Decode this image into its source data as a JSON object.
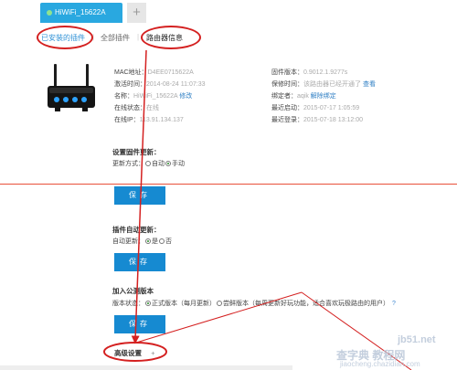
{
  "tabs": {
    "device_label": "HiWiFi_15622A",
    "add_label": "+"
  },
  "subnav": {
    "installed": "已安装的插件",
    "sep": "|",
    "all": "全部插件",
    "router_info": "路由器信息"
  },
  "router": {
    "left": [
      {
        "label": "MAC地址：",
        "value": "D4EE0715622A"
      },
      {
        "label": "激活时间：",
        "value": "2014-08-24 11:07:33"
      },
      {
        "label": "名称：",
        "value": "HiWiFi_15622A",
        "link": "修改"
      },
      {
        "label": "在线状态：",
        "value": "在线"
      },
      {
        "label": "在线IP：",
        "value": "113.91.134.137"
      }
    ],
    "right": [
      {
        "label": "固件版本：",
        "value": "0.9012.1.9277s"
      },
      {
        "label": "保修时间：",
        "value": "该路由器已经开通了",
        "link": "查看"
      },
      {
        "label": "绑定者：",
        "value": "aqik",
        "link": "解除绑定"
      },
      {
        "label": "最近启动：",
        "value": "2015-07-17 1:05:59"
      },
      {
        "label": "最近登录：",
        "value": "2015-07-18 13:12:00"
      }
    ]
  },
  "firmware_update": {
    "title": "设置固件更新：",
    "mode_label": "更新方式：",
    "option_auto": "自动",
    "option_manual": "手动"
  },
  "save_label": "保存",
  "plugin_update": {
    "title": "插件自动更新：",
    "label": "自动更新：",
    "option_yes": "是",
    "option_no": "否"
  },
  "beta": {
    "title": "加入公测版本",
    "label": "版本状态：",
    "option_official": "正式版本（每月更新）",
    "option_beta": "尝鲜版本（每周更新好玩功能，适合喜欢玩极路由的用户）",
    "help": "?"
  },
  "advanced": {
    "label": "高级设置",
    "plus": "+"
  },
  "watermark": {
    "line1": "jb51.net",
    "line2": "查字典 教程网",
    "line3": "jiaocheng.chazidian.com"
  },
  "colors": {
    "tab_active": "#29a8e0",
    "save_button": "#168ad1",
    "annotation_red": "#d42020",
    "link": "#2f7fc4"
  },
  "icons": {
    "router": "router-icon"
  }
}
